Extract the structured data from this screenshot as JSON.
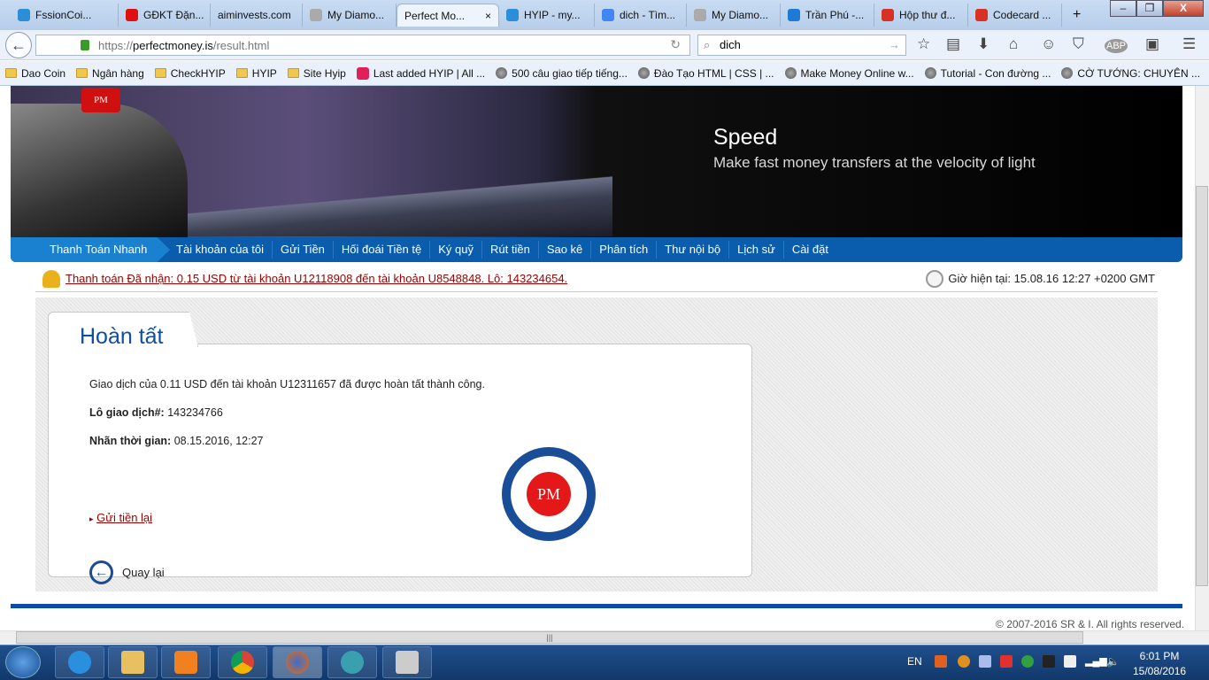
{
  "browser": {
    "tabs": [
      {
        "label": "FssionCoi...",
        "icon": "hyip-icon",
        "color": "#2a8fd8"
      },
      {
        "label": "GĐKT Đặn...",
        "icon": "t-icon",
        "color": "#e01010"
      },
      {
        "label": "aiminvests.com",
        "icon": "",
        "color": ""
      },
      {
        "label": "My Diamo...",
        "icon": "diamond-icon",
        "color": "#aaaaaa"
      },
      {
        "label": "Perfect Mo...",
        "icon": "",
        "color": "",
        "active": true
      },
      {
        "label": "HYIP - my...",
        "icon": "hyip-icon",
        "color": "#2a8fd8"
      },
      {
        "label": "dich - Tìm...",
        "icon": "google-icon",
        "color": "#4285f4"
      },
      {
        "label": "My Diamo...",
        "icon": "diamond-icon",
        "color": "#aaaaaa"
      },
      {
        "label": "Trần Phú -...",
        "icon": "c-icon",
        "color": "#1e7ad6"
      },
      {
        "label": "Hộp thư đ...",
        "icon": "gmail-icon",
        "color": "#d93025"
      },
      {
        "label": "Codecard ...",
        "icon": "gmail-icon",
        "color": "#d93025"
      }
    ],
    "new_tab": "+",
    "url_prefix": "https://",
    "url_domain": "perfectmoney.is",
    "url_path": "/result.html",
    "search_value": "dich",
    "bookmarks": [
      {
        "label": "Dao Coin",
        "icon": "folder-icon"
      },
      {
        "label": "Ngân hàng",
        "icon": "folder-icon"
      },
      {
        "label": "CheckHYIP",
        "icon": "folder-icon"
      },
      {
        "label": "HYIP",
        "icon": "folder-icon"
      },
      {
        "label": "Site Hyip",
        "icon": "folder-icon"
      },
      {
        "label": "Last added HYIP | All ...",
        "icon": "a-icon"
      },
      {
        "label": "500 câu giao tiếp tiếng...",
        "icon": "globe-icon"
      },
      {
        "label": "Đào Tạo HTML | CSS | ...",
        "icon": "globe-icon"
      },
      {
        "label": "Make Money Online w...",
        "icon": "globe-icon"
      },
      {
        "label": "Tutorial - Con đường ...",
        "icon": "globe-icon"
      },
      {
        "label": "CỜ TƯỚNG: CHUYÊN ...",
        "icon": "globe-icon"
      }
    ],
    "bookmarks_more": "»"
  },
  "banner": {
    "title": "Speed",
    "subtitle": "Make fast money transfers at the velocity of light",
    "logo": "PM"
  },
  "menu": {
    "quick": "Thanh Toán Nhanh",
    "items": [
      "Tài khoản của tôi",
      "Gửi Tiền",
      "Hối đoái Tiền tệ",
      "Ký quỹ",
      "Rút tiền",
      "Sao kê",
      "Phân tích",
      "Thư nội bộ",
      "Lịch sử",
      "Cài đặt"
    ]
  },
  "notice": {
    "text": "Thanh toán Đã nhận: 0.15 USD từ tài khoản U12118908 đến tài khoản U8548848. Lô: 143234654.",
    "time": "Giờ hiện tại: 15.08.16 12:27 +0200 GMT"
  },
  "result": {
    "title": "Hoàn tất",
    "message": "Giao dịch của 0.11 USD đến tài khoản U12311657 đã được hoàn tất thành công.",
    "batch_label": "Lô giao dịch#:",
    "batch_value": "143234766",
    "timestamp_label": "Nhãn thời gian:",
    "timestamp_value": "08.15.2016, 12:27",
    "resend": "Gửi tiền lại",
    "back": "Quay lại",
    "stamp": "PM"
  },
  "footer": {
    "copyright": "© 2007-2016 SR & I. All rights reserved."
  },
  "taskbar": {
    "lang": "EN",
    "time": "6:01 PM",
    "date": "15/08/2016"
  },
  "colors": {
    "brand_blue": "#0a5cac",
    "link_red": "#9b0000",
    "title_blue": "#0f4fa0"
  }
}
